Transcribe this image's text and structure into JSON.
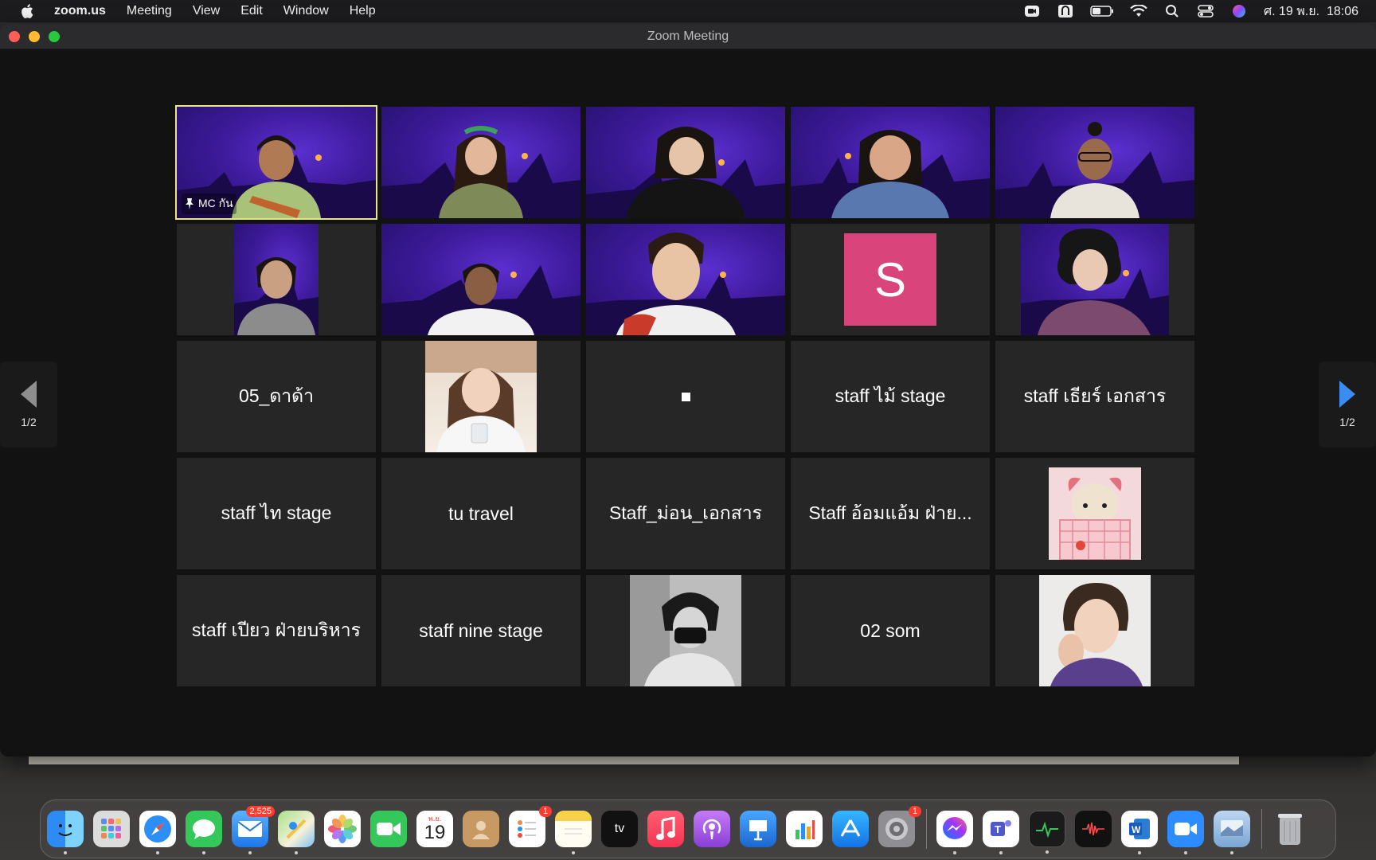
{
  "menubar": {
    "app_name": "zoom.us",
    "menus": [
      "Meeting",
      "View",
      "Edit",
      "Window",
      "Help"
    ],
    "datetime": "ศ. 19 พ.ย.  18:06"
  },
  "window": {
    "title": "Zoom Meeting"
  },
  "gallery": {
    "pinned_label": "MC กัน",
    "tiles": [
      {
        "type": "video"
      },
      {
        "type": "video"
      },
      {
        "type": "video"
      },
      {
        "type": "video"
      },
      {
        "type": "video"
      },
      {
        "type": "video"
      },
      {
        "type": "video"
      },
      {
        "type": "video"
      },
      {
        "type": "avatar",
        "letter": "S"
      },
      {
        "type": "video"
      },
      {
        "type": "name",
        "name": "05_ดาด้า"
      },
      {
        "type": "photo"
      },
      {
        "type": "marker"
      },
      {
        "type": "name",
        "name": "staff ไม้ stage"
      },
      {
        "type": "name",
        "name": "staff เธียร์ เอกสาร"
      },
      {
        "type": "name",
        "name": "staff ไท stage"
      },
      {
        "type": "name",
        "name": "tu travel"
      },
      {
        "type": "name",
        "name": "Staff_ม่อน_เอกสาร"
      },
      {
        "type": "name",
        "name": "Staff อ้อมแอ้ม ฝ่าย..."
      },
      {
        "type": "photo"
      },
      {
        "type": "name",
        "name": "staff เปียว ฝ่ายบริหาร"
      },
      {
        "type": "name",
        "name": "staff nine stage"
      },
      {
        "type": "photo"
      },
      {
        "type": "name",
        "name": "02 som"
      },
      {
        "type": "photo"
      }
    ]
  },
  "pager": {
    "left_count": "1/2",
    "right_count": "1/2"
  },
  "dock": {
    "mail_badge": "2,525",
    "reminders_badge": "1",
    "settings_badge": "1",
    "calendar_month": "พ.ย.",
    "calendar_day": "19",
    "tv_label": "tv"
  },
  "colors": {
    "active_speaker": "#e8e58a",
    "tile_bg": "#262626",
    "avatar_s": "#d9457a",
    "pager_arrow_right": "#3b8cf0"
  }
}
